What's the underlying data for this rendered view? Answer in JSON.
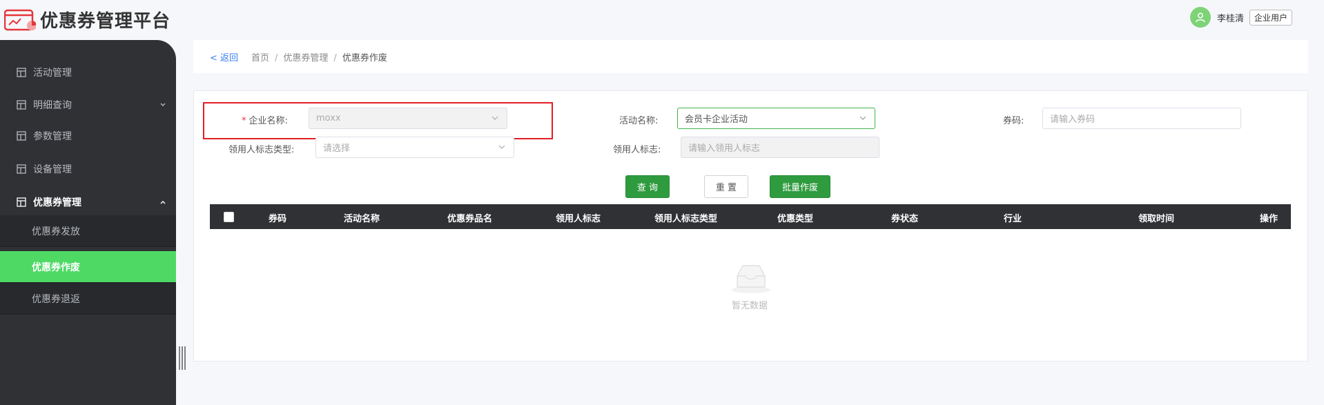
{
  "header": {
    "app_title": "优惠券管理平台",
    "user_name": "李桂清",
    "user_role": "企业用户"
  },
  "sidebar": {
    "items": [
      {
        "label": "活动管理"
      },
      {
        "label": "明细查询"
      },
      {
        "label": "参数管理"
      },
      {
        "label": "设备管理"
      },
      {
        "label": "优惠券管理"
      }
    ],
    "sub_items": [
      {
        "label": "优惠券发放"
      },
      {
        "label": "优惠券作废"
      },
      {
        "label": "优惠券退返"
      }
    ]
  },
  "breadcrumb": {
    "back": "< 返回",
    "home": "首页",
    "parent": "优惠券管理",
    "current": "优惠券作废",
    "separator": "/"
  },
  "form": {
    "company_label": "企业名称:",
    "company_required": "*",
    "company_value": "moxx",
    "activity_label": "活动名称:",
    "activity_value": "会员卡企业活动",
    "code_label": "券码:",
    "code_placeholder": "请输入券码",
    "mark_type_label": "领用人标志类型:",
    "mark_type_placeholder": "请选择",
    "mark_label": "领用人标志:",
    "mark_placeholder": "请输入领用人标志"
  },
  "buttons": {
    "query": "查 询",
    "reset": "重 置",
    "batch_void": "批量作废"
  },
  "table": {
    "columns": [
      "券码",
      "活动名称",
      "优惠券品名",
      "领用人标志",
      "领用人标志类型",
      "优惠类型",
      "券状态",
      "行业",
      "领取时间",
      "操作"
    ],
    "empty_text": "暂无数据"
  },
  "colors": {
    "accent_green": "#4ed965",
    "button_green": "#2f9b3f",
    "sidebar_bg": "#2f3135",
    "highlight_red": "#e31c23"
  }
}
